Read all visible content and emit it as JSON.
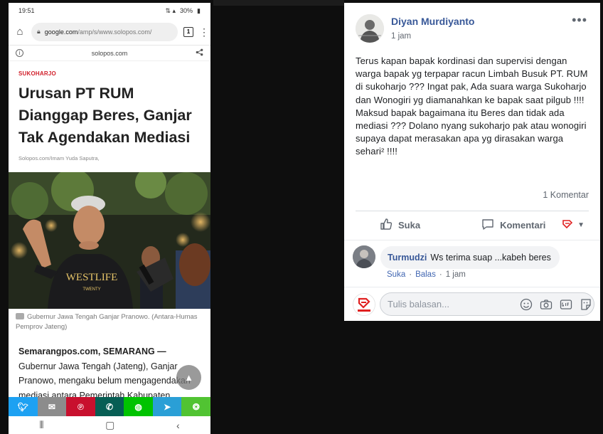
{
  "phone": {
    "status": {
      "time": "19:51",
      "battery": "30%"
    },
    "browser": {
      "url_host": "google.com",
      "url_path": "/amp/s/www.solopos.com/",
      "tab_count": "1",
      "amp_domain": "solopos.com"
    },
    "article": {
      "category": "SUKOHARJO",
      "headline": "Urusan PT RUM Dianggap Beres, Ganjar Tak Agendakan Mediasi",
      "byline": "Solopos.com/Imam Yuda Saputra,",
      "photo_shirt_text_1": "WESTLIFE",
      "photo_shirt_text_2": "TWENTY",
      "photo_caption": "Gubernur Jawa Tengah Ganjar Pranowo. (Antara-Humas Pemprov Jateng)",
      "body_lead": "Semarangpos.com, SEMARANG —",
      "body_text": " Gubernur Jawa Tengah (Jateng), Ganjar Pranowo, mengaku belum mengagendakan mediasi antara Pemerintah Kabupaten (Pemkab)"
    },
    "share_buttons": [
      {
        "name": "twitter",
        "color": "#1da1f2"
      },
      {
        "name": "email",
        "color": "#8c8c8c"
      },
      {
        "name": "pinterest",
        "color": "#c8102e"
      },
      {
        "name": "whatsapp",
        "color": "#075e54"
      },
      {
        "name": "line",
        "color": "#00c300"
      },
      {
        "name": "telegram",
        "color": "#2a9fd6"
      },
      {
        "name": "wechat",
        "color": "#51c332"
      }
    ]
  },
  "post": {
    "author": "Diyan Murdiyanto",
    "time": "1 jam",
    "text": "Terus kapan bapak kordinasi dan supervisi dengan warga bapak yg terpapar racun Limbah Busuk PT. RUM di sukoharjo ??? Ingat pak, Ada suara warga Sukoharjo dan Wonogiri yg diamanahkan ke bapak saat pilgub !!!! Maksud bapak bagaimana itu Beres dan tidak ada mediasi ??? Dolano nyang sukoharjo pak atau wonogiri supaya dapat merasakan apa yg dirasakan warga sehari² !!!!",
    "comment_count": "1 Komentar",
    "like_label": "Suka",
    "comment_label": "Komentari",
    "comment": {
      "name": "Turmudzi",
      "text": "Ws terima suap ...kabeh beres",
      "like": "Suka",
      "sep": "·",
      "reply": "Balas",
      "time": "1 jam"
    },
    "reply_placeholder": "Tulis balasan...",
    "accent": "#385898"
  }
}
